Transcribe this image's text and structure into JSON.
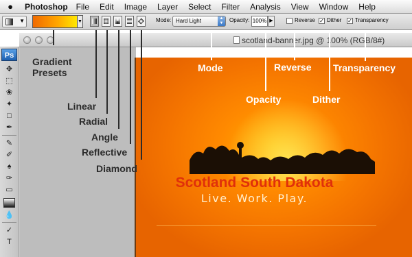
{
  "menu_bar": {
    "app_name": "Photoshop",
    "items": [
      "File",
      "Edit",
      "Image",
      "Layer",
      "Select",
      "Filter",
      "Analysis",
      "View",
      "Window",
      "Help"
    ]
  },
  "options_bar": {
    "mode_label": "Mode:",
    "mode_value": "Hard Light",
    "opacity_label": "Opacity:",
    "opacity_value": "100%",
    "reverse_label": "Reverse",
    "reverse_checked": false,
    "dither_label": "Dither",
    "dither_checked": true,
    "transparency_label": "Transparency",
    "transparency_checked": true,
    "gradient_colors": [
      "#f06a00",
      "#ffa500",
      "#ffe800"
    ],
    "gradient_types": [
      "linear",
      "radial",
      "angle",
      "reflective",
      "diamond"
    ],
    "active_gradient_type": "linear"
  },
  "toolbox": {
    "logo": "Ps"
  },
  "document": {
    "title": "scotland-banner.jpg @ 100% (RGB/8#)"
  },
  "banner": {
    "title": "Scotland South Dakota",
    "tagline": "Live. Work. Play."
  },
  "callouts": {
    "gradient_presets": "Gradient\nPresets",
    "linear": "Linear",
    "radial": "Radial",
    "angle": "Angle",
    "reflective": "Reflective",
    "diamond": "Diamond",
    "mode": "Mode",
    "opacity": "Opacity",
    "reverse": "Reverse",
    "dither": "Dither",
    "transparency": "Transparency"
  },
  "colors": {
    "banner_orange": "#f47400",
    "title_red": "#e0300a",
    "callout_dark": "#2b2b2b",
    "callout_light": "#ffffff"
  }
}
